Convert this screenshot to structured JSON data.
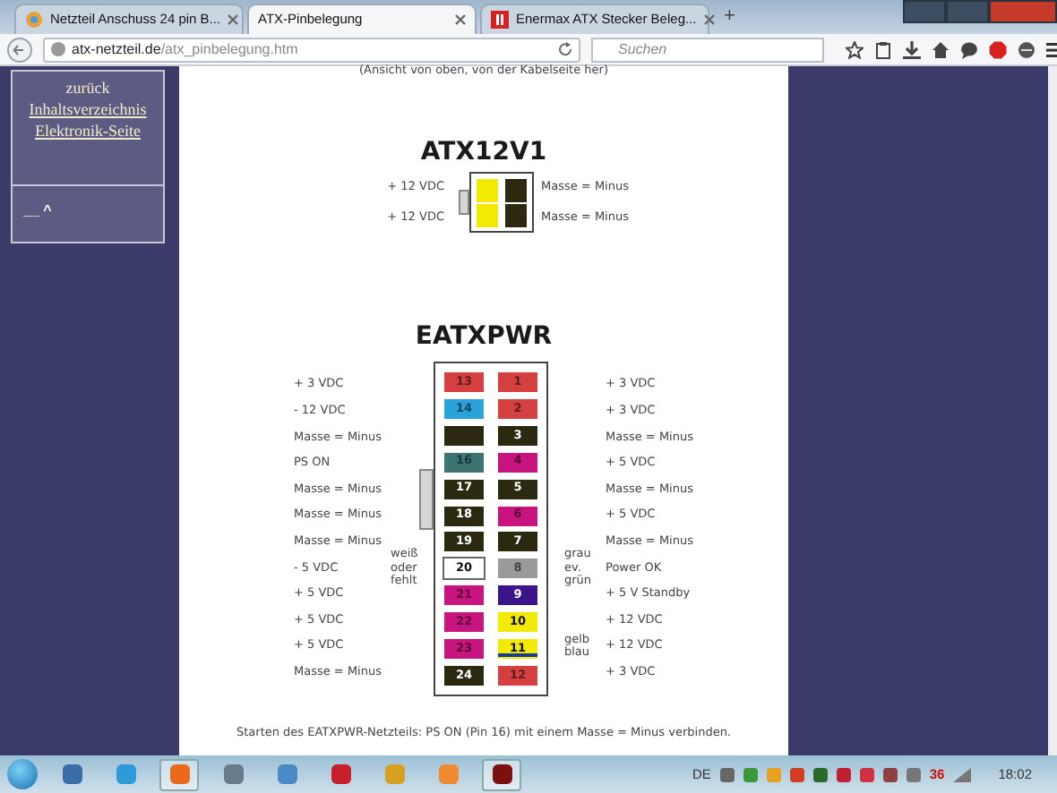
{
  "browser": {
    "tabs": [
      {
        "label": "Netzteil Anschuss 24 pin B...",
        "selected": false
      },
      {
        "label": "ATX-Pinbelegung",
        "selected": true
      },
      {
        "label": "Enermax ATX Stecker Beleg...",
        "selected": false
      }
    ],
    "new_tab": "+",
    "address": {
      "domain": "atx-netzteil.de",
      "path": "/atx_pinbelegung.htm"
    },
    "search": {
      "placeholder": "Suchen"
    }
  },
  "sidebar": {
    "links": [
      {
        "text": "zurück",
        "kind": "text"
      },
      {
        "text": "Inhaltsverzeichnis",
        "kind": "link"
      },
      {
        "text": "Elektronik-Seite",
        "kind": "link"
      }
    ],
    "footer": "__ ^"
  },
  "page": {
    "caption": "(Ansicht von oben, von der Kabelseite her)",
    "atx12v1": {
      "title": "ATX12V1",
      "rows": [
        {
          "left": "+ 12 VDC",
          "pins": [
            {
              "color": "#f2ea00"
            },
            {
              "color": "#2b2a10"
            }
          ],
          "right": "Masse = Minus"
        },
        {
          "left": "+ 12 VDC",
          "pins": [
            {
              "color": "#f2ea00"
            },
            {
              "color": "#2b2a10"
            }
          ],
          "right": "Masse = Minus"
        }
      ]
    },
    "eatxpwr": {
      "title": "EATXPWR",
      "rows": [
        {
          "left": "+ 3 VDC",
          "pins": [
            {
              "label": "13",
              "color": "#d44040"
            },
            {
              "label": "1",
              "color": "#d44040"
            }
          ],
          "right": "+ 3 VDC"
        },
        {
          "left": "- 12 VDC",
          "pins": [
            {
              "label": "14",
              "color": "#2aa2da"
            },
            {
              "label": "2",
              "color": "#d44040"
            }
          ],
          "right": "+ 3 VDC"
        },
        {
          "left": "Masse = Minus",
          "pins": [
            {
              "color": "#2b2a10"
            },
            {
              "label": "3",
              "color": "#2b2a10"
            }
          ],
          "right": "Masse = Minus"
        },
        {
          "left": "PS ON",
          "pins": [
            {
              "label": "16",
              "color": "#3c7474"
            },
            {
              "label": "4",
              "color": "#c8147e"
            }
          ],
          "right": "+ 5 VDC"
        },
        {
          "left": "Masse = Minus",
          "pins": [
            {
              "label": "17",
              "color": "#2b2a10"
            },
            {
              "label": "5",
              "color": "#2b2a10"
            }
          ],
          "right": "Masse = Minus"
        },
        {
          "left": "Masse = Minus",
          "pins": [
            {
              "label": "18",
              "color": "#2b2a10"
            },
            {
              "label": "6",
              "color": "#c8147e"
            }
          ],
          "right": "+ 5 VDC"
        },
        {
          "left": "Masse = Minus",
          "pins": [
            {
              "label": "19",
              "color": "#2b2a10"
            },
            {
              "label": "7",
              "color": "#2b2a10"
            }
          ],
          "right": "Masse = Minus"
        },
        {
          "left": "- 5 VDC",
          "pins": [
            {
              "label": "20",
              "color": "#ffffff",
              "annotation": "weiß oder fehlt"
            },
            {
              "label": "8",
              "color": "#9a9a9a",
              "annotation": "grau ev. grün"
            }
          ],
          "right": "Power OK"
        },
        {
          "left": "+ 5 VDC",
          "pins": [
            {
              "label": "21",
              "color": "#c8147e"
            },
            {
              "label": "9",
              "color": "#3a1488"
            }
          ],
          "right": "+ 5 V Standby"
        },
        {
          "left": "+ 5 VDC",
          "pins": [
            {
              "label": "22",
              "color": "#c8147e"
            },
            {
              "label": "10",
              "color": "#f2ea00"
            }
          ],
          "right": "+ 12 VDC"
        },
        {
          "left": "+ 5 VDC",
          "pins": [
            {
              "label": "23",
              "color": "#c8147e"
            },
            {
              "label": "11",
              "color": "#f2ea00",
              "stripe": {
                "color": "#1a3aa0"
              },
              "annotation": "gelb blau"
            }
          ],
          "right": "+ 12 VDC"
        },
        {
          "left": "Masse = Minus",
          "pins": [
            {
              "label": "24",
              "color": "#2b2a10"
            },
            {
              "label": "12",
              "color": "#d44040"
            }
          ],
          "right": "+ 3 VDC"
        }
      ]
    },
    "note": "Starten des EATXPWR-Netzteils: PS ON (Pin 16) mit einem Masse = Minus verbinden."
  },
  "taskbar": {
    "language": "DE",
    "tray_number": "36",
    "time": "18:02"
  }
}
